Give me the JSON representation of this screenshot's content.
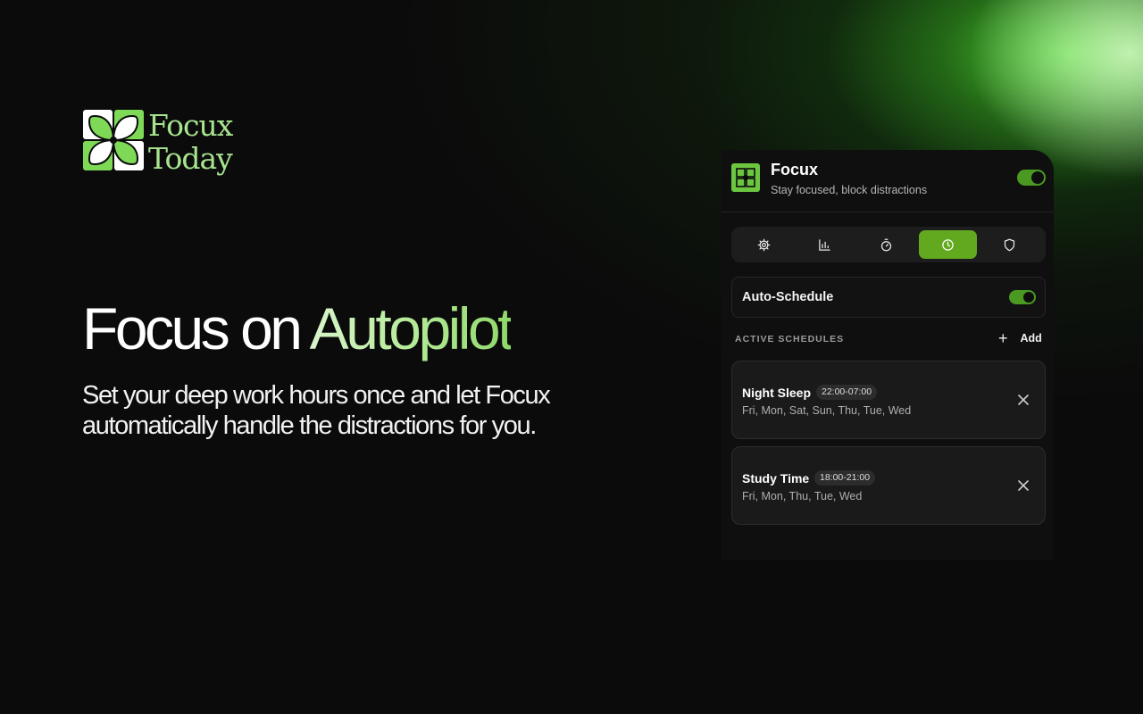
{
  "brand": {
    "line1": "Focux",
    "line2": "Today",
    "icon": "clover-logo-icon",
    "color": "#7ed957"
  },
  "hero": {
    "title_part1": "Focus on ",
    "title_part2": "Autopilot",
    "subtitle_line1": "Set your deep work hours once and let Focux",
    "subtitle_line2": "automatically handle the distractions for you."
  },
  "panel": {
    "app_name": "Focux",
    "tagline": "Stay focused, block distractions",
    "enabled": true,
    "accent": "#62a920",
    "tabs": [
      {
        "icon": "gear-icon",
        "active": false
      },
      {
        "icon": "bar-chart-icon",
        "active": false
      },
      {
        "icon": "stopwatch-icon",
        "active": false
      },
      {
        "icon": "clock-icon",
        "active": true
      },
      {
        "icon": "shield-icon",
        "active": false
      }
    ],
    "auto_schedule": {
      "label": "Auto-Schedule",
      "enabled": true
    },
    "section_title": "ACTIVE SCHEDULES",
    "add_label": "Add",
    "schedules": [
      {
        "name": "Night Sleep",
        "time": "22:00-07:00",
        "days": "Fri, Mon, Sat, Sun, Thu, Tue, Wed"
      },
      {
        "name": "Study Time",
        "time": "18:00-21:00",
        "days": "Fri, Mon, Thu, Tue, Wed"
      }
    ]
  }
}
